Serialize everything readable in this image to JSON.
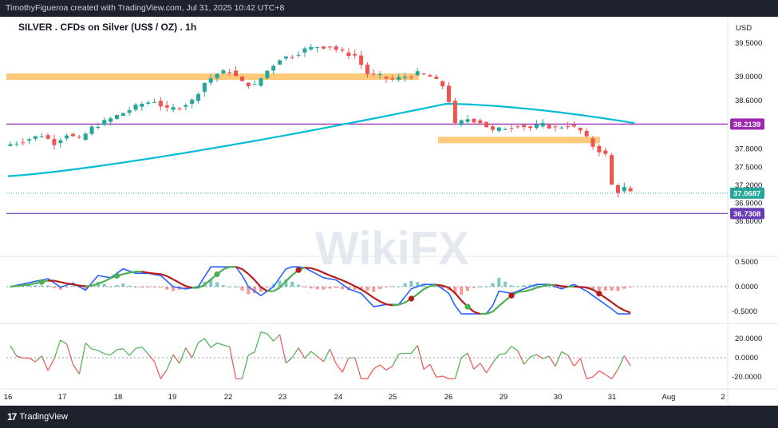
{
  "header": {
    "caption": "TimothyFigueroa created with TradingView.com, Jul 31, 2025 10:42 UTC+8"
  },
  "footer": {
    "brand": "TradingView",
    "logo_text": "17"
  },
  "watermark": "WikiFX",
  "chart_data": {
    "type": "candlestick",
    "title": "SILVER . CFDs on Silver (US$ / OZ) . 1h",
    "currency": "USD",
    "x_ticks": [
      "16",
      "17",
      "18",
      "19",
      "22",
      "23",
      "24",
      "25",
      "26",
      "29",
      "30",
      "31",
      "Aug",
      "2"
    ],
    "price_axis_ticks": [
      "39.5000",
      "39.0000",
      "38.6000",
      "37.8000",
      "37.5000",
      "37.2000",
      "36.9000",
      "36.6000"
    ],
    "price_tags": [
      {
        "value": "38.2139",
        "color": "#9c27b0"
      },
      {
        "value": "37.0687",
        "color": "#26a69a"
      },
      {
        "value": "36.7308",
        "color": "#673ab7"
      }
    ],
    "levels": [
      {
        "type": "zone",
        "price": 39.0,
        "color": "#ffb74d"
      },
      {
        "type": "zone",
        "price": 37.95,
        "color": "#ffb74d"
      },
      {
        "type": "line",
        "price": 38.2139,
        "color": "#9c27b0"
      },
      {
        "type": "line",
        "price": 36.7308,
        "color": "#673ab7"
      },
      {
        "type": "dotted",
        "price": 37.0687,
        "color": "#26a69a"
      }
    ],
    "moving_average": {
      "color": "#00bcd4",
      "start": 37.35,
      "peak": 38.55,
      "end": 38.23
    },
    "price_path": [
      [
        0,
        37.85
      ],
      [
        6,
        38.03
      ],
      [
        8,
        37.9
      ],
      [
        10,
        38.05
      ],
      [
        12,
        37.95
      ],
      [
        14,
        38.15
      ],
      [
        16,
        38.25
      ],
      [
        18,
        38.35
      ],
      [
        20,
        38.45
      ],
      [
        22,
        38.55
      ],
      [
        24,
        38.6
      ],
      [
        26,
        38.45
      ],
      [
        28,
        38.5
      ],
      [
        30,
        38.6
      ],
      [
        32,
        38.9
      ],
      [
        34,
        39.05
      ],
      [
        36,
        39.1
      ],
      [
        38,
        38.9
      ],
      [
        40,
        38.85
      ],
      [
        42,
        39.1
      ],
      [
        44,
        39.3
      ],
      [
        46,
        39.35
      ],
      [
        48,
        39.45
      ],
      [
        50,
        39.5
      ],
      [
        52,
        39.5
      ],
      [
        54,
        39.4
      ],
      [
        56,
        39.35
      ],
      [
        58,
        39.05
      ],
      [
        60,
        39.0
      ],
      [
        62,
        38.95
      ],
      [
        64,
        39.0
      ],
      [
        66,
        39.05
      ],
      [
        68,
        39.0
      ],
      [
        70,
        38.85
      ],
      [
        71,
        38.6
      ],
      [
        72,
        38.2
      ],
      [
        74,
        38.3
      ],
      [
        76,
        38.25
      ],
      [
        78,
        38.1
      ],
      [
        80,
        38.15
      ],
      [
        82,
        38.2
      ],
      [
        84,
        38.15
      ],
      [
        86,
        38.2
      ],
      [
        88,
        38.15
      ],
      [
        90,
        38.2
      ],
      [
        92,
        38.1
      ],
      [
        94,
        37.85
      ],
      [
        96,
        37.7
      ],
      [
        97,
        37.2
      ],
      [
        98,
        37.1
      ],
      [
        99,
        37.15
      ],
      [
        100,
        37.07
      ]
    ],
    "candles": 100,
    "macd": {
      "ticks": [
        "0.5000",
        "0.0000",
        "-0.5000"
      ],
      "macd_color": "#2962ff",
      "signal_colors": {
        "up": "#4caf50",
        "down": "#b71c1c"
      },
      "hist_colors": {
        "up": "#26a69a",
        "down": "#ef5350"
      }
    },
    "oscillator": {
      "ticks": [
        "20.0000",
        "0.0000",
        "-20.0000"
      ],
      "colors": {
        "up": "#4caf50",
        "down": "#ef5350"
      }
    }
  }
}
